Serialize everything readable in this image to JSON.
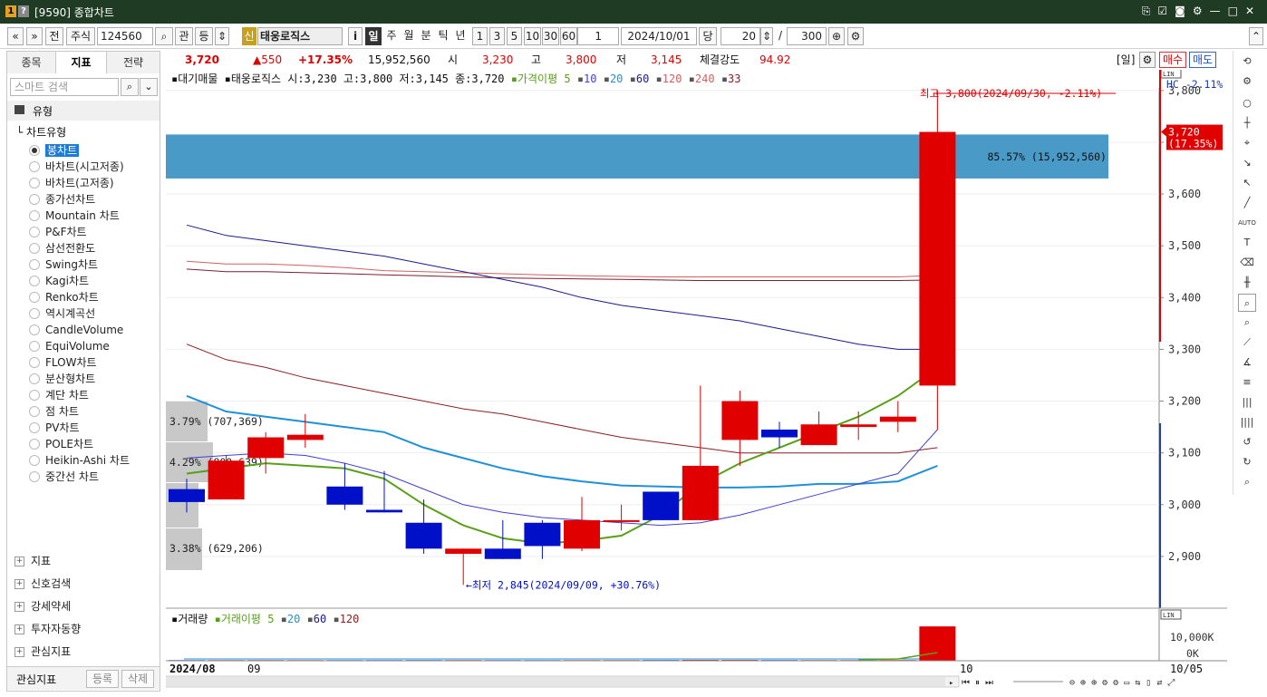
{
  "window": {
    "title": "[9590] 종합차트",
    "badge1": "1",
    "badge2": "?"
  },
  "toolbar": {
    "nav_prev": "«",
    "nav_down": "»",
    "prev_label": "전",
    "market": "주식",
    "code": "124560",
    "search_icon": "⌕",
    "related": "관",
    "updown": "등",
    "credit": "신",
    "stock_name": "태웅로직스",
    "info": "i",
    "periods": [
      "일",
      "주",
      "월",
      "분",
      "틱",
      "년"
    ],
    "active_period": "일",
    "intervals": [
      "1",
      "3",
      "5",
      "10",
      "30",
      "60"
    ],
    "interval_value": "1",
    "date": "2024/10/01",
    "per_label": "당",
    "count": "20",
    "slash": "/",
    "total": "300"
  },
  "quote": {
    "price": "3,720",
    "change": "▲550",
    "change_pct": "+17.35%",
    "volume": "15,952,560",
    "open_label": "시",
    "open": "3,230",
    "high_label": "고",
    "high": "3,800",
    "low_label": "저",
    "low": "3,145",
    "strength_label": "체결강도",
    "strength": "94.92",
    "day_tag": "[일]",
    "buy_label": "매수",
    "sell_label": "매도"
  },
  "left_panel": {
    "tabs": [
      "종목",
      "지표",
      "전략"
    ],
    "active_tab": "지표",
    "search_placeholder": "스마트 검색",
    "group_label": "유형",
    "tree_label": "차트유형",
    "chart_types": [
      "봉차트",
      "바차트(시고저종)",
      "바차트(고저종)",
      "종가선차트",
      "Mountain 차트",
      "P&F차트",
      "삼선전환도",
      "Swing차트",
      "Kagi차트",
      "Renko차트",
      "역시계곡선",
      "CandleVolume",
      "EquiVolume",
      "FLOW차트",
      "분산형차트",
      "계단 차트",
      "점 차트",
      "PV차트",
      "POLE차트",
      "Heikin-Ashi 차트",
      "중간선 차트"
    ],
    "selected_type": "봉차트",
    "sections": [
      "지표",
      "신호검색",
      "강세약세",
      "투자자동향",
      "관심지표"
    ],
    "fav_label": "관심지표",
    "register_btn": "등록",
    "delete_btn": "삭제"
  },
  "chart": {
    "legend_prefix": "대기매물",
    "legend_info": "태웅로직스 시:3,230 고:3,800 저:3,145 종:3,720",
    "ma_label": "가격이평 5",
    "ma_periods": [
      "10",
      "20",
      "60",
      "120",
      "240",
      "33"
    ],
    "high_annot": "최고 3,800(2024/09/30, -2.11%)",
    "low_annot": "최저 2,845(2024/09/09, +30.76%)",
    "hc_label": "HC  -2.11%",
    "price_tag": "3,720",
    "price_tag_pct": "(17.35%)",
    "y_ticks": [
      "3,800",
      "3,700",
      "3,600",
      "3,500",
      "3,400",
      "3,300",
      "3,200",
      "3,100",
      "3,000",
      "2,900"
    ],
    "volume_profile": [
      {
        "label": "85.57% (15,952,560)"
      },
      {
        "label": "3.79% (707,369)"
      },
      {
        "label": "4.29% (800,639)"
      },
      {
        "label": ""
      },
      {
        "label": "3.38% (629,206)"
      }
    ],
    "vol_legend": "거래량",
    "vol_ma_label": "거래이평 5",
    "vol_ma_periods": [
      "20",
      "60",
      "120"
    ],
    "vol_ticks": [
      "10,000K",
      "0K"
    ],
    "x_labels": [
      "2024/08",
      "09",
      "10"
    ],
    "x_end": "10/05",
    "scale_tag": "LIN"
  },
  "chart_data": {
    "type": "candlestick",
    "candles": [
      {
        "o": 3030,
        "h": 3050,
        "l": 2985,
        "c": 3005
      },
      {
        "o": 3010,
        "h": 3095,
        "l": 3010,
        "c": 3085
      },
      {
        "o": 3090,
        "h": 3140,
        "l": 3060,
        "c": 3130
      },
      {
        "o": 3125,
        "h": 3175,
        "l": 3110,
        "c": 3135
      },
      {
        "o": 3035,
        "h": 3080,
        "l": 2990,
        "c": 3000
      },
      {
        "o": 2990,
        "h": 3065,
        "l": 2985,
        "c": 2985
      },
      {
        "o": 2965,
        "h": 3010,
        "l": 2905,
        "c": 2915
      },
      {
        "o": 2905,
        "h": 2915,
        "l": 2845,
        "c": 2915
      },
      {
        "o": 2915,
        "h": 2970,
        "l": 2895,
        "c": 2895
      },
      {
        "o": 2965,
        "h": 2970,
        "l": 2895,
        "c": 2920
      },
      {
        "o": 2915,
        "h": 3015,
        "l": 2910,
        "c": 2970
      },
      {
        "o": 2970,
        "h": 3000,
        "l": 2950,
        "c": 2970
      },
      {
        "o": 3025,
        "h": 3025,
        "l": 2970,
        "c": 2970
      },
      {
        "o": 2970,
        "h": 3230,
        "l": 2970,
        "c": 3075
      },
      {
        "o": 3125,
        "h": 3220,
        "l": 3075,
        "c": 3200
      },
      {
        "o": 3145,
        "h": 3160,
        "l": 3110,
        "c": 3130
      },
      {
        "o": 3115,
        "h": 3180,
        "l": 3115,
        "c": 3155
      },
      {
        "o": 3150,
        "h": 3180,
        "l": 3125,
        "c": 3155
      },
      {
        "o": 3160,
        "h": 3200,
        "l": 3140,
        "c": 3170
      },
      {
        "o": 3230,
        "h": 3800,
        "l": 3145,
        "c": 3720
      }
    ],
    "ma5": [
      3060,
      3070,
      3080,
      3075,
      3070,
      3050,
      3000,
      2960,
      2935,
      2925,
      2930,
      2940,
      2980,
      3040,
      3080,
      3110,
      3140,
      3170,
      3210,
      3265
    ],
    "ma20": [
      3210,
      3180,
      3170,
      3160,
      3150,
      3140,
      3110,
      3090,
      3070,
      3055,
      3045,
      3037,
      3035,
      3033,
      3033,
      3035,
      3040,
      3040,
      3045,
      3075
    ],
    "ma60": [
      3540,
      3520,
      3510,
      3500,
      3490,
      3480,
      3465,
      3450,
      3435,
      3420,
      3400,
      3385,
      3375,
      3365,
      3355,
      3340,
      3325,
      3310,
      3300,
      3300
    ],
    "ma120": [
      3470,
      3465,
      3465,
      3462,
      3458,
      3452,
      3450,
      3448,
      3446,
      3444,
      3442,
      3441,
      3440,
      3440,
      3440,
      3440,
      3440,
      3440,
      3440,
      3443
    ],
    "ma240": [
      3455,
      3450,
      3450,
      3448,
      3446,
      3444,
      3442,
      3440,
      3438,
      3437,
      3436,
      3435,
      3434,
      3433,
      3433,
      3433,
      3433,
      3433,
      3433,
      3434
    ],
    "ma33": [
      3310,
      3280,
      3265,
      3245,
      3230,
      3215,
      3200,
      3185,
      3175,
      3160,
      3145,
      3130,
      3120,
      3110,
      3100,
      3100,
      3100,
      3100,
      3100,
      3110
    ],
    "volume": [
      300,
      310,
      320,
      300,
      290,
      300,
      310,
      320,
      300,
      290,
      300,
      310,
      330,
      400,
      380,
      320,
      310,
      300,
      330,
      15952
    ]
  }
}
